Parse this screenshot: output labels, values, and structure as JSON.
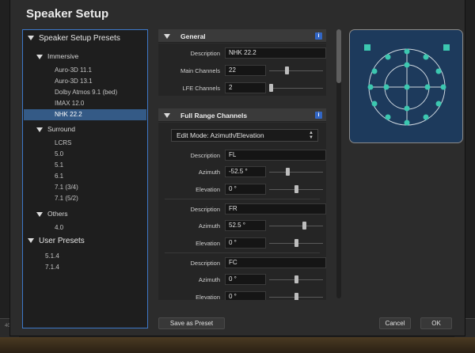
{
  "dialog": {
    "title": "Speaker Setup"
  },
  "presets": {
    "root_label": "Speaker Setup Presets",
    "groups": [
      {
        "label": "Immersive",
        "items": [
          "Auro-3D 11.1",
          "Auro-3D 13.1",
          "Dolby Atmos 9.1 (bed)",
          "IMAX 12.0",
          "NHK 22.2"
        ]
      },
      {
        "label": "Surround",
        "items": [
          "LCRS",
          "5.0",
          "5.1",
          "6.1",
          "7.1 (3/4)",
          "7.1 (5/2)"
        ]
      },
      {
        "label": "Others",
        "items": [
          "4.0"
        ]
      }
    ],
    "selected": "NHK 22.2",
    "user_label": "User Presets",
    "user_items": [
      "5.1.4",
      "7.1.4"
    ]
  },
  "general": {
    "title": "General",
    "description_label": "Description",
    "description_value": "NHK 22.2",
    "main_channels_label": "Main Channels",
    "main_channels_value": "22",
    "main_channels_level": 0.33,
    "lfe_channels_label": "LFE Channels",
    "lfe_channels_value": "2",
    "lfe_channels_level": 0.04
  },
  "full_range": {
    "title": "Full Range Channels",
    "edit_mode": "Edit Mode: Azimuth/Elevation",
    "channels": [
      {
        "description_label": "Description",
        "description": "FL",
        "azimuth_label": "Azimuth",
        "azimuth": "-52.5 °",
        "azimuth_level": 0.35,
        "elevation_label": "Elevation",
        "elevation": "0 °",
        "elevation_level": 0.5
      },
      {
        "description_label": "Description",
        "description": "FR",
        "azimuth_label": "Azimuth",
        "azimuth": "52.5 °",
        "azimuth_level": 0.65,
        "elevation_label": "Elevation",
        "elevation": "0 °",
        "elevation_level": 0.5
      },
      {
        "description_label": "Description",
        "description": "FC",
        "azimuth_label": "Azimuth",
        "azimuth": "0 °",
        "azimuth_level": 0.5,
        "elevation_label": "Elevation",
        "elevation": "0 °",
        "elevation_level": 0.5
      }
    ]
  },
  "info_icon": "i",
  "buttons": {
    "save_preset": "Save as Preset",
    "cancel": "Cancel",
    "ok": "OK"
  },
  "host": {
    "ruler_value": "40"
  },
  "colors": {
    "viz_bg": "#1d3a5c",
    "speaker": "#3cc7b0",
    "selection": "#345a86",
    "accent": "#3d78c8"
  }
}
